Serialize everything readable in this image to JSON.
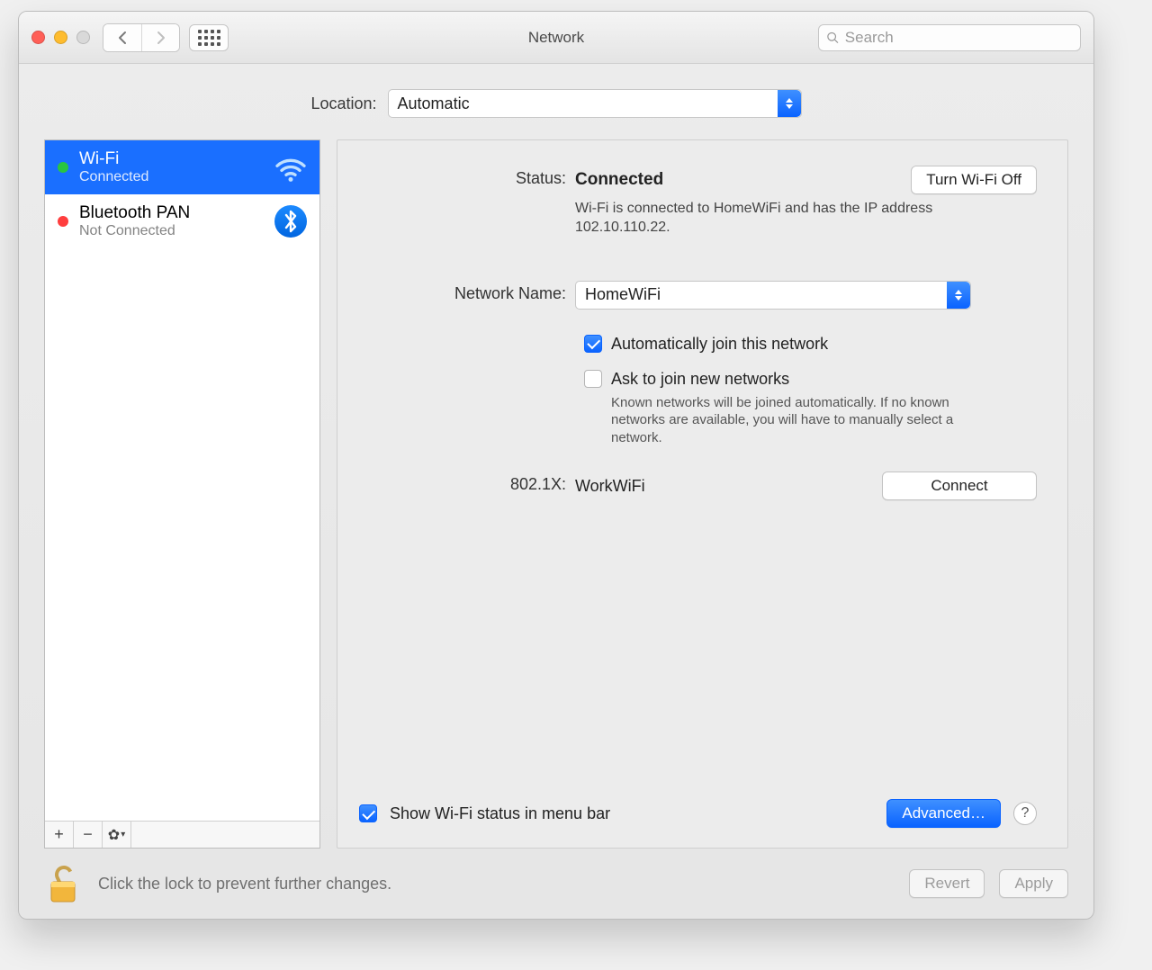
{
  "window": {
    "title": "Network"
  },
  "toolbar": {
    "search_placeholder": "Search"
  },
  "location": {
    "label": "Location:",
    "selected": "Automatic"
  },
  "sidebar": {
    "items": [
      {
        "name": "Wi-Fi",
        "status": "Connected",
        "dot": "green",
        "icon": "wifi",
        "selected": true
      },
      {
        "name": "Bluetooth PAN",
        "status": "Not Connected",
        "dot": "red",
        "icon": "bluetooth",
        "selected": false
      }
    ]
  },
  "detail": {
    "status_label": "Status:",
    "status_value": "Connected",
    "status_desc": "Wi-Fi is connected to HomeWiFi and has the IP address 102.10.110.22.",
    "toggle_wifi": "Turn Wi-Fi Off",
    "network_name_label": "Network Name:",
    "network_name_value": "HomeWiFi",
    "auto_join_label": "Automatically join this network",
    "auto_join_checked": true,
    "ask_join_label": "Ask to join new networks",
    "ask_join_checked": false,
    "ask_join_desc": "Known networks will be joined automatically. If no known networks are available, you will have to manually select a network.",
    "dot1x_label": "802.1X:",
    "dot1x_value": "WorkWiFi",
    "connect_label": "Connect",
    "show_status_label": "Show Wi-Fi status in menu bar",
    "show_status_checked": true,
    "advanced_label": "Advanced…"
  },
  "bottom": {
    "lock_text": "Click the lock to prevent further changes.",
    "revert": "Revert",
    "apply": "Apply"
  }
}
